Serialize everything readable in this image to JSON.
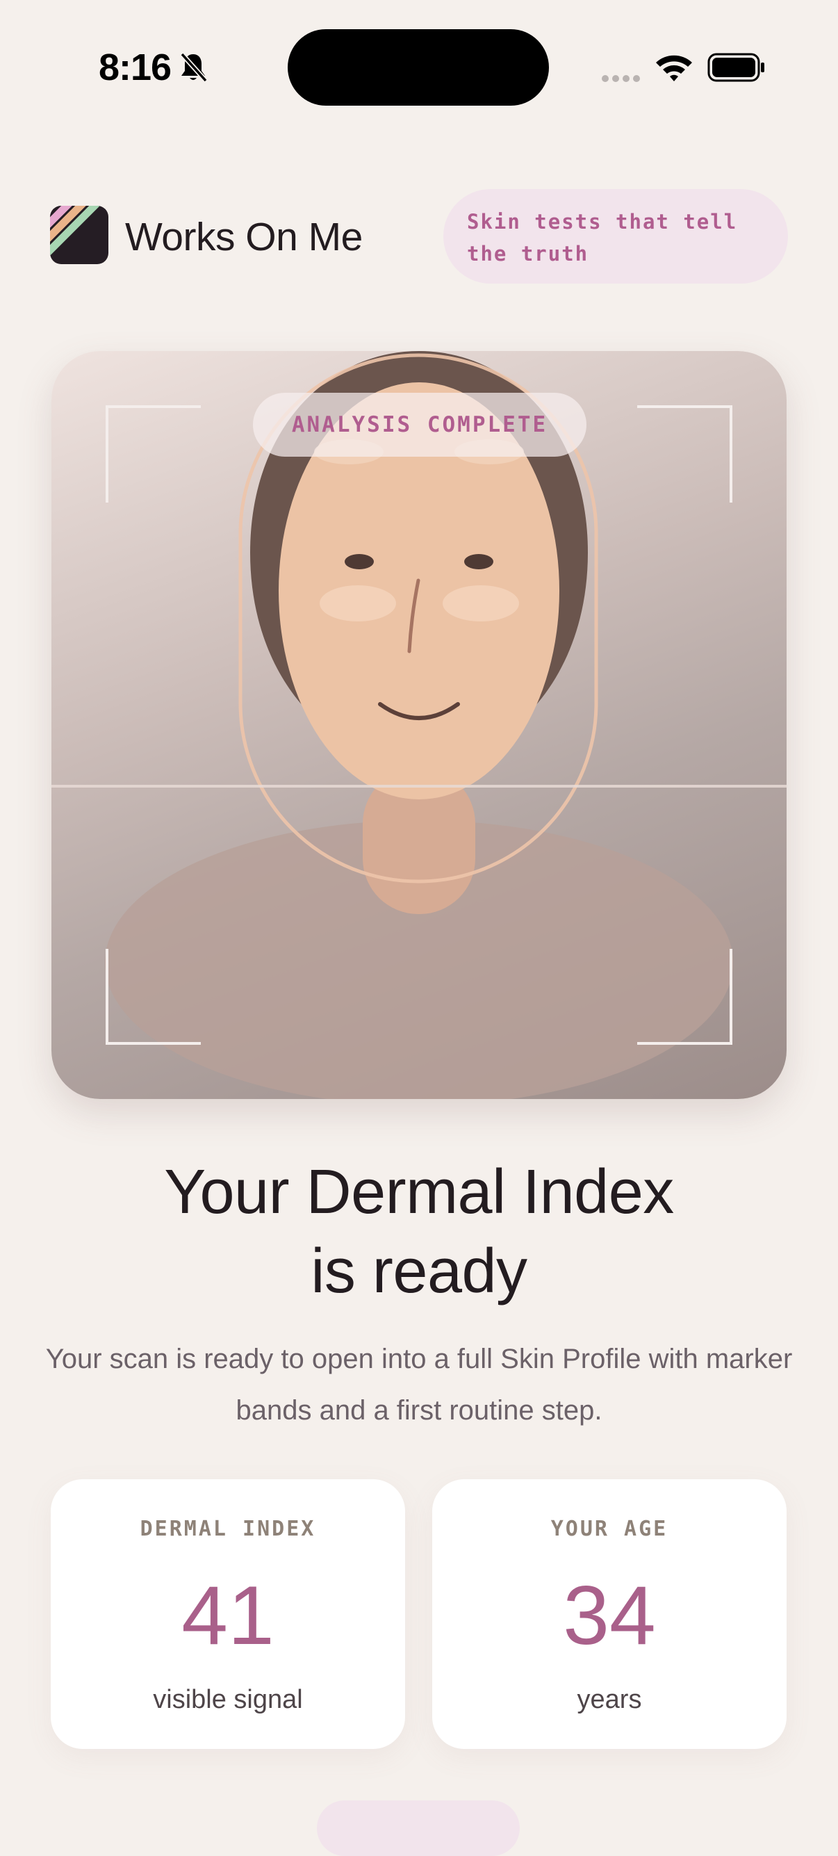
{
  "status_bar": {
    "time": "8:16"
  },
  "header": {
    "app_name": "Works On Me",
    "tagline": "Skin tests that tell the truth"
  },
  "scan": {
    "status_label": "ANALYSIS COMPLETE"
  },
  "result": {
    "headline_line1": "Your Dermal Index",
    "headline_line2": "is ready",
    "description": "Your scan is ready to open into a full Skin Profile with marker bands and a first routine step."
  },
  "metrics": [
    {
      "label": "DERMAL INDEX",
      "value": "41",
      "unit": "visible signal"
    },
    {
      "label": "YOUR AGE",
      "value": "34",
      "unit": "years"
    }
  ],
  "colors": {
    "accent": "#a9608a",
    "pill_bg": "#f2e4ec",
    "background": "#f5f0ec"
  }
}
